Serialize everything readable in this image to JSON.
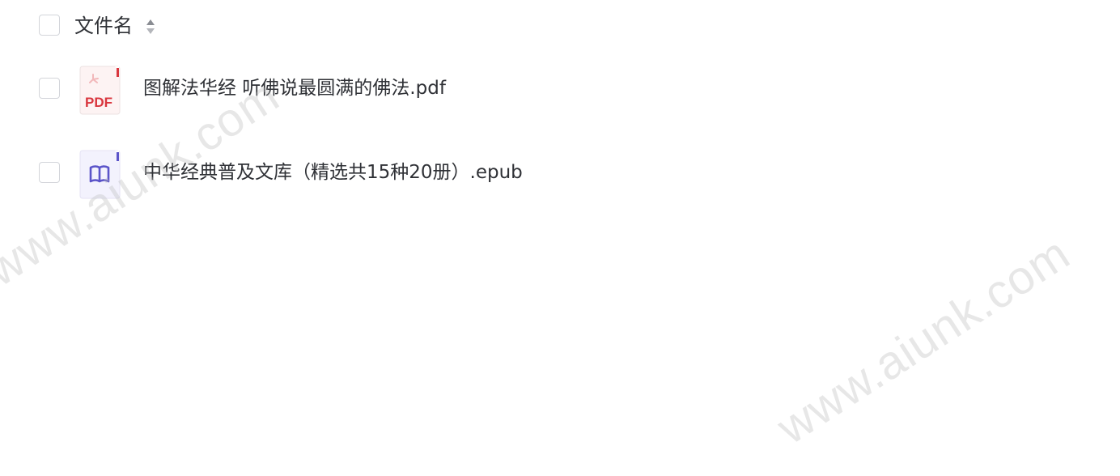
{
  "header": {
    "column_label": "文件名",
    "sort_icon": "sort-both-icon"
  },
  "files": [
    {
      "name": "图解法华经 听佛说最圆满的佛法.pdf",
      "icon": "pdf-file-icon",
      "icon_text": "PDF",
      "accent": "#d9363e"
    },
    {
      "name": "中华经典普及文库（精选共15种20册）.epub",
      "icon": "epub-file-icon",
      "accent": "#5b54c9"
    }
  ],
  "watermark": {
    "text": "www.aiunk.com"
  }
}
